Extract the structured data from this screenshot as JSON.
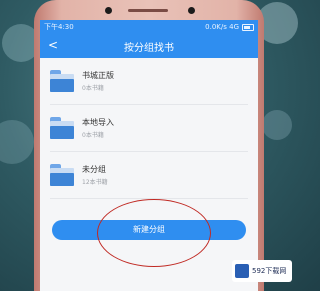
{
  "status_bar": {
    "left": "下午4:30",
    "right": "0.0K/s 4G"
  },
  "nav": {
    "title": "按分组找书"
  },
  "groups": [
    {
      "name": "书城正版",
      "count": "0本书籍"
    },
    {
      "name": "本地导入",
      "count": "0本书籍"
    },
    {
      "name": "未分组",
      "count": "12本书籍"
    }
  ],
  "new_group_button": {
    "label": "新建分组"
  },
  "watermark": {
    "text": "592下载网"
  },
  "colors": {
    "accent": "#2f8ef0",
    "annotation": "#c02a24"
  }
}
